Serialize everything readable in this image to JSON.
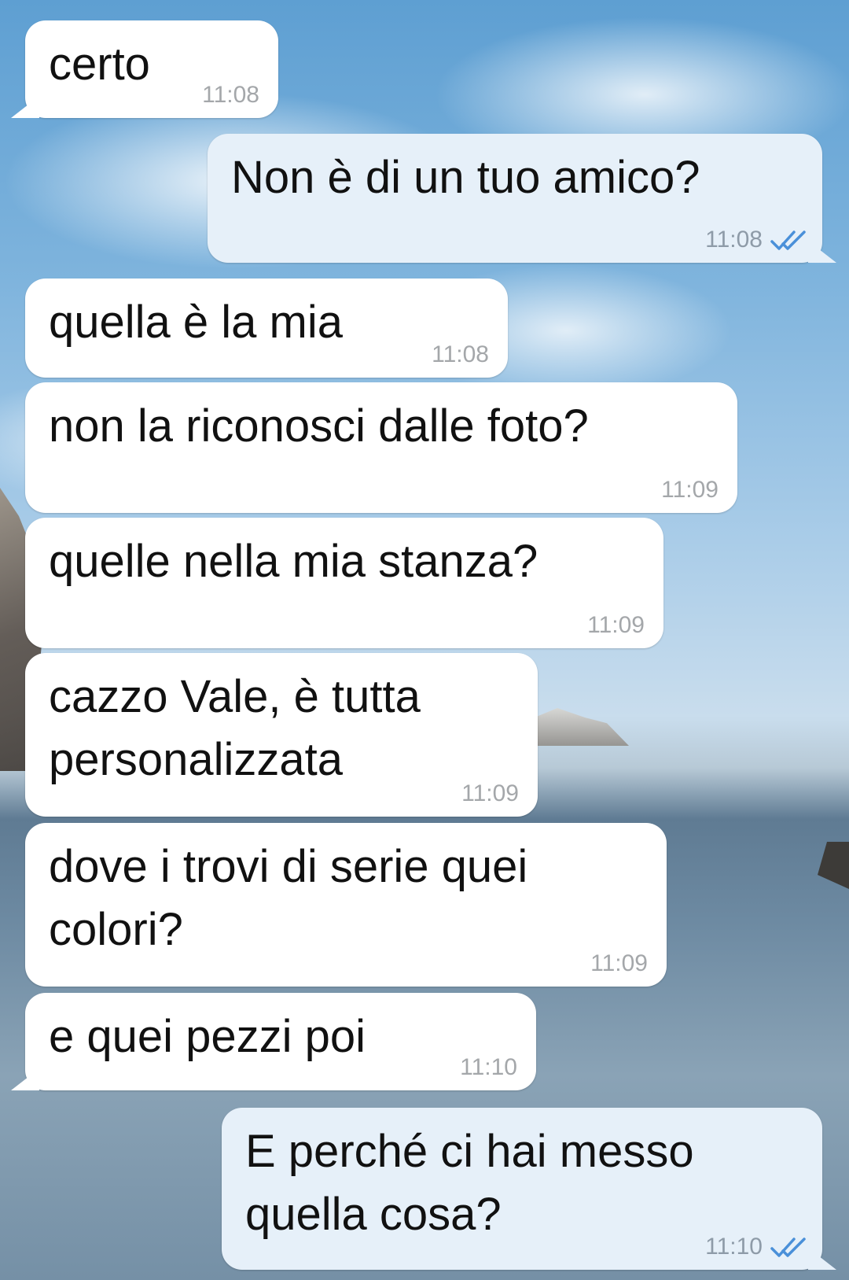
{
  "colors": {
    "incoming_bubble": "#ffffff",
    "outgoing_bubble": "#e6f0f9",
    "timestamp": "#a4a7aa",
    "read_check": "#4a90d9"
  },
  "messages": [
    {
      "direction": "in",
      "text": "certo",
      "time": "11:08"
    },
    {
      "direction": "out",
      "text": "Non è di un tuo amico?",
      "time": "11:08",
      "status_icon": "double-check-icon"
    },
    {
      "direction": "in",
      "text": "quella è la mia",
      "time": "11:08"
    },
    {
      "direction": "in",
      "text": "non la riconosci dalle foto?",
      "time": "11:09"
    },
    {
      "direction": "in",
      "text": "quelle nella mia stanza?",
      "time": "11:09"
    },
    {
      "direction": "in",
      "text": "cazzo Vale, è tutta\npersonalizzata",
      "time": "11:09"
    },
    {
      "direction": "in",
      "text": "dove i trovi di serie quei\ncolori?",
      "time": "11:09"
    },
    {
      "direction": "in",
      "text": "e quei pezzi poi",
      "time": "11:10"
    },
    {
      "direction": "out",
      "text": "E perché ci hai messo\nquella cosa?",
      "time": "11:10",
      "status_icon": "double-check-icon"
    }
  ]
}
